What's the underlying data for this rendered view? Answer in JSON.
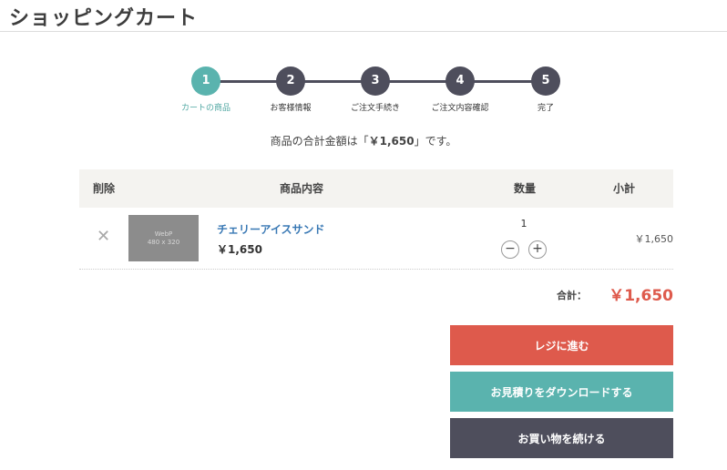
{
  "page": {
    "title": "ショッピングカート"
  },
  "steps": [
    {
      "number": "1",
      "label": "カートの商品"
    },
    {
      "number": "2",
      "label": "お客様情報"
    },
    {
      "number": "3",
      "label": "ご注文手続き"
    },
    {
      "number": "4",
      "label": "ご注文内容確認"
    },
    {
      "number": "5",
      "label": "完了"
    }
  ],
  "active_step": "1",
  "summary": {
    "before": "商品の合計金額は「",
    "amount": "￥1,650",
    "after": "」です。"
  },
  "table": {
    "headers": {
      "remove": "削除",
      "product": "商品内容",
      "quantity": "数量",
      "subtotal": "小計"
    }
  },
  "item": {
    "remove_glyph": "✕",
    "thumb_line1": "WebP",
    "thumb_line2": "480 x 320",
    "name": "チェリーアイスサンド",
    "price": "￥1,650",
    "quantity": "1",
    "minus_glyph": "−",
    "plus_glyph": "+",
    "subtotal": "￥1,650"
  },
  "total": {
    "label": "合計：",
    "value": "￥1,650"
  },
  "buttons": {
    "checkout": "レジに進む",
    "quote": "お見積りをダウンロードする",
    "continue": "お買い物を続ける"
  },
  "colors": {
    "accent_teal": "#5ab3ae",
    "step_dark": "#4e4e5c",
    "checkout_red": "#de5a4c",
    "total_red": "#de5a4c",
    "continue_dark": "#4e4e5c"
  },
  "icons": {
    "remove": "close-icon",
    "decrease": "minus-icon",
    "increase": "plus-icon"
  }
}
